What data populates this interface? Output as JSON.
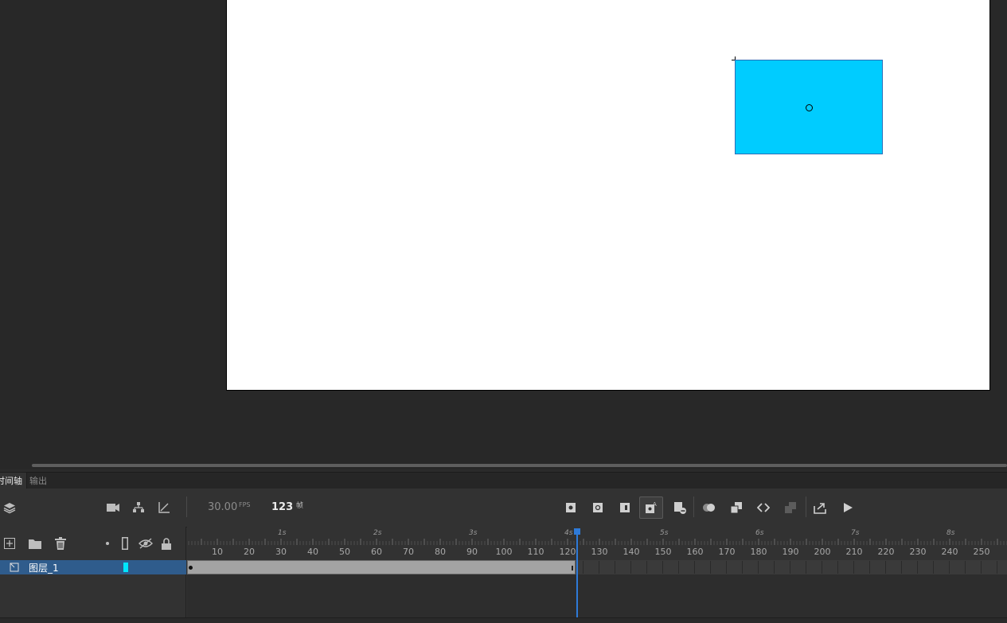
{
  "panel_tabs": {
    "timeline": "时间轴",
    "output": "输出"
  },
  "timeline": {
    "fps_value": "30.00",
    "fps_unit": "FPS",
    "current_frame": "123",
    "frame_unit": "帧",
    "seconds_labels": [
      "1s",
      "2s",
      "3s",
      "4s",
      "5s",
      "6s",
      "7s",
      "8s"
    ],
    "frame_numbers": [
      "10",
      "20",
      "30",
      "40",
      "50",
      "60",
      "70",
      "80",
      "90",
      "100",
      "110",
      "120",
      "130",
      "140",
      "150",
      "160",
      "170",
      "180",
      "190",
      "200",
      "210",
      "220",
      "230",
      "240",
      "250"
    ],
    "layers": [
      {
        "name": "图层_1",
        "outline_color": "#00e5ff",
        "selected": true
      }
    ],
    "span_start_frame": 1,
    "span_end_frame": 122,
    "playhead_frame": 123
  },
  "stage": {
    "background": "#ffffff",
    "shape_fill": "#00ccff"
  },
  "icons": {
    "toolbar_left": [
      "layers-icon",
      "camera-icon",
      "layer-parenting-icon",
      "graph-icon"
    ],
    "toolbar_center": [
      "keyframe-icon",
      "blank-keyframe-icon",
      "frame-icon",
      "auto-keyframe-icon",
      "insert-frame-icon",
      "onion-skin-icon",
      "edit-multiple-frames-icon",
      "swap-icon",
      "loop-icon",
      "export-icon",
      "play-icon"
    ],
    "layer_header": [
      "new-layer-icon",
      "new-folder-icon",
      "delete-icon",
      "dot-icon",
      "outline-icon",
      "hide-icon",
      "lock-icon"
    ]
  }
}
